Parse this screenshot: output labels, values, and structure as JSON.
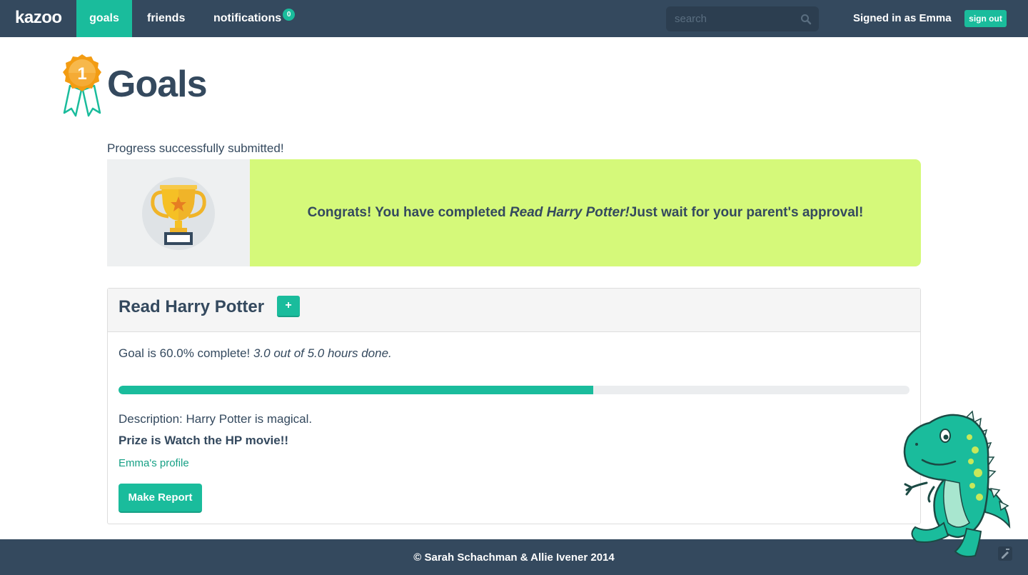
{
  "navbar": {
    "brand": "kazoo",
    "items": [
      {
        "label": "goals",
        "active": true
      },
      {
        "label": "friends",
        "active": false
      },
      {
        "label": "notifications",
        "active": false,
        "badge": "0"
      }
    ],
    "search": {
      "placeholder": "search",
      "icon": "search-icon"
    },
    "signed_in_text": "Signed in as Emma",
    "sign_out_label": "sign out"
  },
  "header": {
    "badge_number": "1",
    "title": "Goals"
  },
  "flash_message": "Progress successfully submitted!",
  "congrats": {
    "icon": "trophy-icon",
    "prefix": "Congrats! You have completed ",
    "goal_name": "Read Harry Potter!",
    "suffix": "Just wait for your parent's approval!"
  },
  "goal": {
    "title": "Read Harry Potter",
    "add_label": "+",
    "progress_prefix": "Goal is 60.0% complete! ",
    "progress_detail": "3.0 out of 5.0 hours done.",
    "progress_fraction": 0.6,
    "description": "Description: Harry Potter is magical.",
    "prize": "Prize is Watch the HP movie!!",
    "profile_link": "Emma's profile",
    "report_button": "Make Report"
  },
  "footer": {
    "text": "© Sarah Schachman & Allie Ivener 2014"
  },
  "colors": {
    "navbar": "#34495e",
    "accent": "#1abc9c",
    "banner": "#d5f97a",
    "link": "#16a085"
  }
}
